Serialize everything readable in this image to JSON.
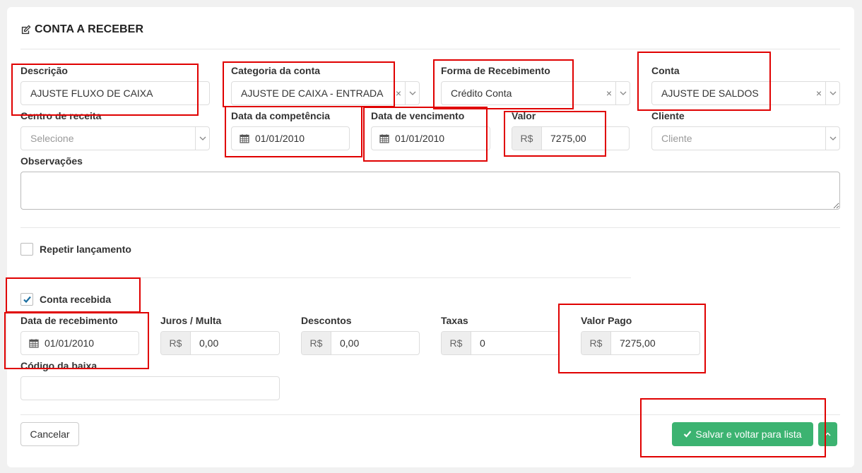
{
  "header": {
    "title": "CONTA A RECEBER",
    "icon": "edit-icon"
  },
  "fields": {
    "descricao": {
      "label": "Descrição",
      "value": "AJUSTE FLUXO DE CAIXA"
    },
    "categoria": {
      "label": "Categoria da conta",
      "value": "AJUSTE DE CAIXA - ENTRADA"
    },
    "forma": {
      "label": "Forma de Recebimento",
      "value": "Crédito Conta"
    },
    "conta": {
      "label": "Conta",
      "value": "AJUSTE DE SALDOS"
    },
    "centro": {
      "label": "Centro de receita",
      "placeholder": "Selecione"
    },
    "competencia": {
      "label": "Data da competência",
      "value": "01/01/2010"
    },
    "vencimento": {
      "label": "Data de vencimento",
      "value": "01/01/2010"
    },
    "valor": {
      "label": "Valor",
      "prefix": "R$",
      "value": "7275,00"
    },
    "cliente": {
      "label": "Cliente",
      "placeholder": "Cliente"
    },
    "observacoes": {
      "label": "Observações"
    }
  },
  "repeat": {
    "label": "Repetir lançamento",
    "checked": false
  },
  "received": {
    "label": "Conta recebida",
    "checked": true
  },
  "payment": {
    "data_recebimento": {
      "label": "Data de recebimento",
      "value": "01/01/2010"
    },
    "juros": {
      "label": "Juros / Multa",
      "prefix": "R$",
      "value": "0,00"
    },
    "descontos": {
      "label": "Descontos",
      "prefix": "R$",
      "value": "0,00"
    },
    "taxas": {
      "label": "Taxas",
      "prefix": "R$",
      "value": "0"
    },
    "valor_pago": {
      "label": "Valor Pago",
      "prefix": "R$",
      "value": "7275,00"
    },
    "codigo_baixa": {
      "label": "Código da baixa"
    }
  },
  "footer": {
    "cancel_label": "Cancelar",
    "save_label": "Salvar e voltar para lista"
  },
  "colors": {
    "primary": "#3cb371",
    "highlight": "#e00000",
    "check": "#1a6ea0"
  }
}
